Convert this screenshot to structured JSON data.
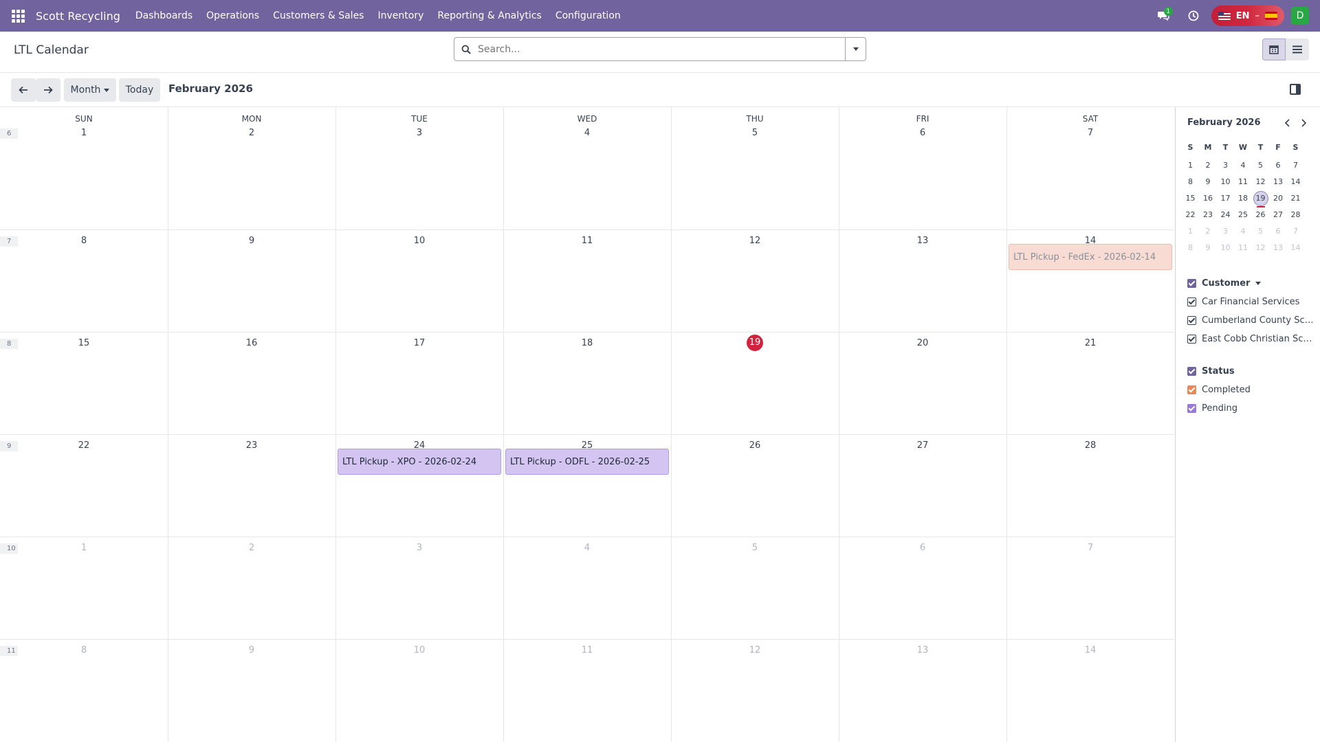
{
  "app": {
    "brand": "Scott Recycling",
    "menu": [
      "Dashboards",
      "Operations",
      "Customers & Sales",
      "Inventory",
      "Reporting & Analytics",
      "Configuration"
    ],
    "messages_count": "1",
    "language": "EN",
    "user_initial": "D"
  },
  "control": {
    "title": "LTL Calendar",
    "search_placeholder": "Search..."
  },
  "toolbar": {
    "scale_label": "Month",
    "today_label": "Today",
    "period_label": "February 2026"
  },
  "calendar": {
    "weekdays": [
      "SUN",
      "MON",
      "TUE",
      "WED",
      "THU",
      "FRI",
      "SAT"
    ],
    "weeks": [
      {
        "number": "6",
        "days": [
          "1",
          "2",
          "3",
          "4",
          "5",
          "6",
          "7"
        ],
        "muted": [
          false,
          false,
          false,
          false,
          false,
          false,
          false
        ]
      },
      {
        "number": "7",
        "days": [
          "8",
          "9",
          "10",
          "11",
          "12",
          "13",
          "14"
        ],
        "muted": [
          false,
          false,
          false,
          false,
          false,
          false,
          false
        ]
      },
      {
        "number": "8",
        "days": [
          "15",
          "16",
          "17",
          "18",
          "19",
          "20",
          "21"
        ],
        "muted": [
          false,
          false,
          false,
          false,
          false,
          false,
          false
        ]
      },
      {
        "number": "9",
        "days": [
          "22",
          "23",
          "24",
          "25",
          "26",
          "27",
          "28"
        ],
        "muted": [
          false,
          false,
          false,
          false,
          false,
          false,
          false
        ]
      },
      {
        "number": "10",
        "days": [
          "1",
          "2",
          "3",
          "4",
          "5",
          "6",
          "7"
        ],
        "muted": [
          true,
          true,
          true,
          true,
          true,
          true,
          true
        ]
      },
      {
        "number": "11",
        "days": [
          "8",
          "9",
          "10",
          "11",
          "12",
          "13",
          "14"
        ],
        "muted": [
          true,
          true,
          true,
          true,
          true,
          true,
          true
        ]
      }
    ],
    "today": {
      "week": 2,
      "day": 4
    },
    "events": [
      {
        "title": "LTL Pickup - FedEx - 2026-02-14",
        "week": 1,
        "day": 6,
        "status": "completed"
      },
      {
        "title": "LTL Pickup - XPO - 2026-02-24",
        "week": 3,
        "day": 2,
        "status": "pending"
      },
      {
        "title": "LTL Pickup - ODFL - 2026-02-25",
        "week": 3,
        "day": 3,
        "status": "pending"
      }
    ]
  },
  "sidebar": {
    "mini_title": "February 2026",
    "mini_weekdays": [
      "S",
      "M",
      "T",
      "W",
      "T",
      "F",
      "S"
    ],
    "mini_weeks": [
      [
        "1",
        "2",
        "3",
        "4",
        "5",
        "6",
        "7"
      ],
      [
        "8",
        "9",
        "10",
        "11",
        "12",
        "13",
        "14"
      ],
      [
        "15",
        "16",
        "17",
        "18",
        "19",
        "20",
        "21"
      ],
      [
        "22",
        "23",
        "24",
        "25",
        "26",
        "27",
        "28"
      ],
      [
        "1",
        "2",
        "3",
        "4",
        "5",
        "6",
        "7"
      ],
      [
        "8",
        "9",
        "10",
        "11",
        "12",
        "13",
        "14"
      ]
    ],
    "mini_muted_from_row": 4,
    "mini_today": {
      "row": 2,
      "col": 4
    },
    "customer_filter": {
      "title": "Customer",
      "items": [
        "Car Financial Services",
        "Cumberland County Schools",
        "East Cobb Christian School"
      ]
    },
    "status_filter": {
      "title": "Status",
      "items": [
        {
          "label": "Completed",
          "color": "#e9895b"
        },
        {
          "label": "Pending",
          "color": "#9b7ad6"
        }
      ]
    }
  },
  "colors": {
    "navbar": "#71639e",
    "today": "#d1233d",
    "pending_event": "#d3c4f2",
    "completed_event": "#f8dcd4"
  }
}
